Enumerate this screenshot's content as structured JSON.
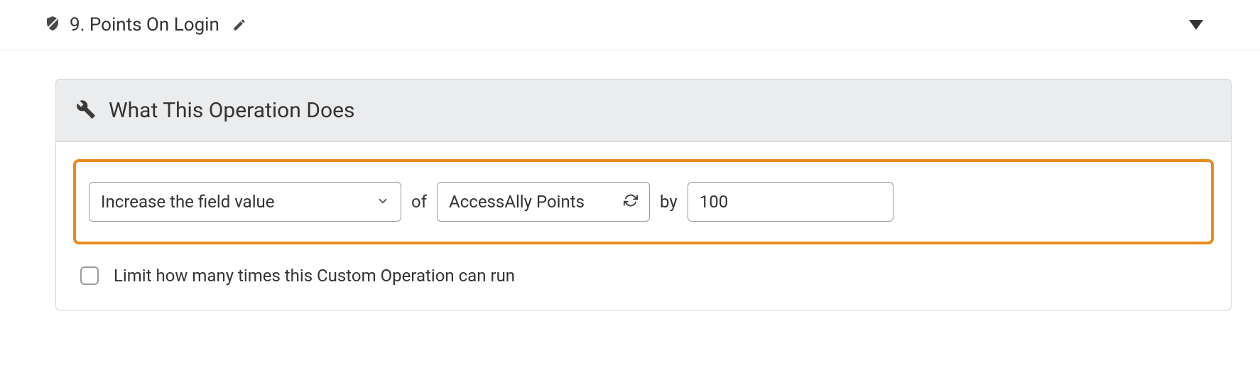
{
  "header": {
    "title": "9. Points On Login"
  },
  "panel": {
    "title": "What This Operation Does"
  },
  "operation": {
    "action_select": "Increase the field value",
    "join_of": "of",
    "field_select": "AccessAlly Points",
    "join_by": "by",
    "value": "100"
  },
  "limit": {
    "label": "Limit how many times this Custom Operation can run"
  }
}
